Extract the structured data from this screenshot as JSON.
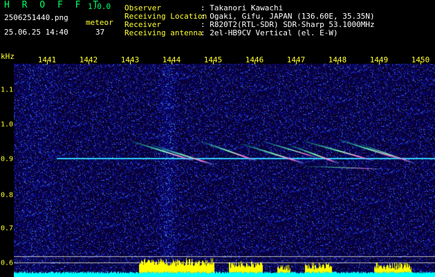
{
  "header": {
    "app_title": "H R O F F T",
    "version": "1.0.0",
    "filename": "2506251440.png",
    "datetime": "25.06.25 14:40",
    "meteor_label": "meteor",
    "meteor_count": "37",
    "rows": [
      {
        "label": "Observer",
        "value": ": Takanori Kawachi"
      },
      {
        "label": "Receiving Location",
        "value": ": Ogaki, Gifu, JAPAN (136.60E, 35.35N)"
      },
      {
        "label": "Receiver",
        "value": ": R820T2(RTL-SDR) SDR-Sharp 53.1000MHz"
      },
      {
        "label": "Receiving antenna",
        "value": ": 2el-HB9CV Vertical (el. E-W)"
      }
    ]
  },
  "axes": {
    "freq_unit": "kHz",
    "time_ticks": [
      "1441",
      "1442",
      "1443",
      "1444",
      "1445",
      "1446",
      "1447",
      "1448",
      "1449",
      "1450"
    ],
    "freq_ticks": [
      "1.1",
      "1.0",
      "0.9",
      "0.8",
      "0.7",
      "0.6"
    ]
  },
  "colors": {
    "background": "#000000",
    "header_label": "#ffff33",
    "title": "#00ff66",
    "noise": "#0a0a8a",
    "carrier": "#33ccff",
    "activity": "#ffff00",
    "baseline": "#00ffff"
  }
}
